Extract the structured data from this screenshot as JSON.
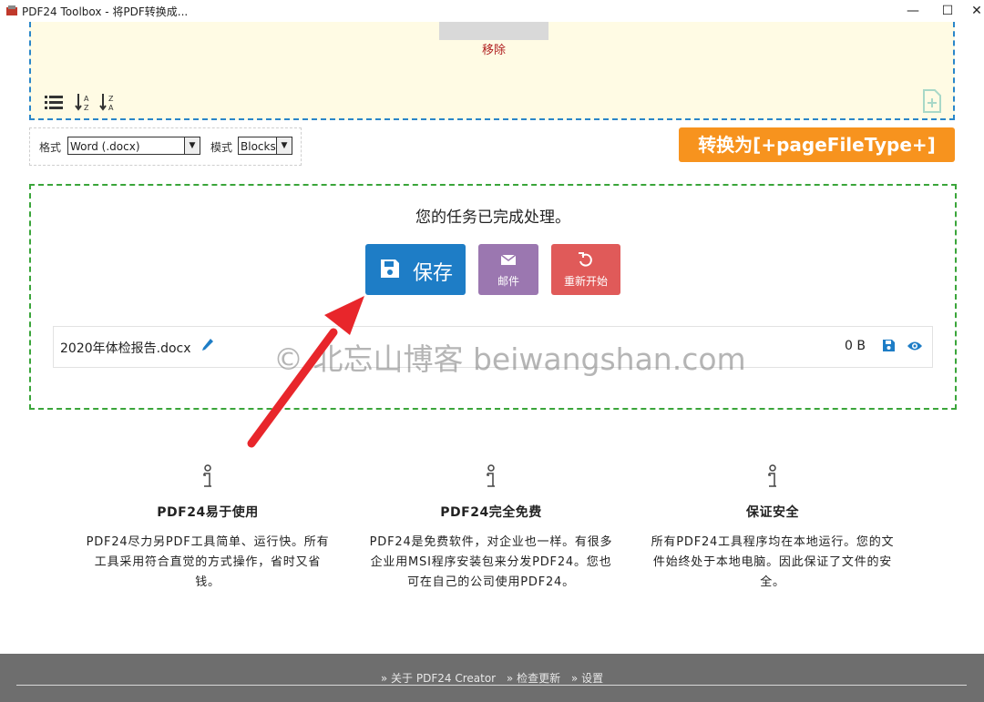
{
  "window": {
    "title": "PDF24 Toolbox - 将PDF转换成...",
    "minimize": "—",
    "maximize": "☐",
    "close": "✕"
  },
  "dropzone": {
    "remove_label": "移除"
  },
  "options": {
    "format_label": "格式",
    "format_value": "Word (.docx)",
    "mode_label": "模式",
    "mode_value": "Blocks"
  },
  "convert_button": "转换为[+pageFileType+]",
  "result": {
    "message": "您的任务已完成处理。",
    "save_label": "保存",
    "mail_label": "邮件",
    "restart_label": "重新开始",
    "file": {
      "name": "2020年体检报告.docx",
      "size": "0 B"
    }
  },
  "watermark": "© 北忘山博客 beiwangshan.com",
  "features": [
    {
      "title": "PDF24易于使用",
      "lines": [
        "PDF24尽力另PDF工具简单、运行快。所有",
        "工具采用符合直觉的方式操作，省时又省",
        "钱。"
      ]
    },
    {
      "title": "PDF24完全免费",
      "lines": [
        "PDF24是免费软件，对企业也一样。有很多",
        "企业用MSI程序安装包来分发PDF24。您也",
        "可在自己的公司使用PDF24。"
      ]
    },
    {
      "title": "保证安全",
      "lines": [
        "所有PDF24工具程序均在本地运行。您的文",
        "件始终处于本地电脑。因此保证了文件的安",
        "全。"
      ]
    }
  ],
  "footer": {
    "links": [
      "» 关于 PDF24 Creator",
      "» 检查更新",
      "» 设置"
    ]
  },
  "colors": {
    "accent_blue": "#1e7dc6",
    "convert_orange": "#f7931e",
    "mail_purple": "#9b77b0",
    "restart_red": "#e05a59",
    "success_green": "#3aa53a",
    "dropzone_bg": "#fffbe4"
  }
}
